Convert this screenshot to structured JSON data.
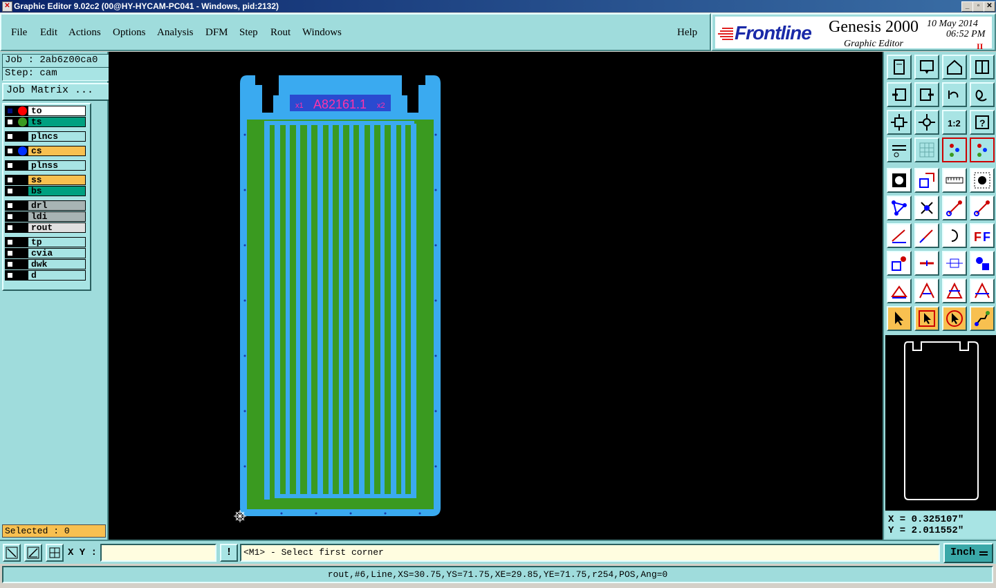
{
  "window": {
    "title": "Graphic Editor 9.02c2 (00@HY-HYCAM-PC041 - Windows, pid:2132)"
  },
  "menu": [
    {
      "label": "File"
    },
    {
      "label": "Edit"
    },
    {
      "label": "Actions"
    },
    {
      "label": "Options"
    },
    {
      "label": "Analysis"
    },
    {
      "label": "DFM"
    },
    {
      "label": "Step"
    },
    {
      "label": "Rout"
    },
    {
      "label": "Windows"
    }
  ],
  "help_label": "Help",
  "brand": {
    "logo_text": "Frontline",
    "product": "Genesis 2000",
    "subtitle": "Graphic Editor",
    "date": "10 May 2014",
    "time": "06:52 PM",
    "pause_mark": "II"
  },
  "job": {
    "job_line": "Job : 2ab6z00ca0",
    "step_line": "Step: cam",
    "matrix_button": "Job Matrix ..."
  },
  "layers": [
    {
      "name": "to",
      "bg": "#ffffff",
      "dot": "#ff0000",
      "active": true
    },
    {
      "name": "ts",
      "bg": "#00a080",
      "dot": "#3a9a20",
      "active": false
    },
    {
      "name": "plncs",
      "bg": "#a8e4e4",
      "dot": "",
      "active": false
    },
    {
      "name": "cs",
      "bg": "#f8c050",
      "dot": "#0030ff",
      "active": false
    },
    {
      "name": "plnss",
      "bg": "#a8e4e4",
      "dot": "",
      "active": false
    },
    {
      "name": "ss",
      "bg": "#f8c050",
      "dot": "",
      "active": false
    },
    {
      "name": "bs",
      "bg": "#00a080",
      "dot": "",
      "active": false
    },
    {
      "name": "drl",
      "bg": "#a8b4b4",
      "dot": "",
      "active": false
    },
    {
      "name": "ldi",
      "bg": "#a8b4b4",
      "dot": "",
      "active": false
    },
    {
      "name": "rout",
      "bg": "#e0e0e0",
      "dot": "",
      "active": false
    },
    {
      "name": "tp",
      "bg": "#a8e4e4",
      "dot": "",
      "active": false
    },
    {
      "name": "cvia",
      "bg": "#a8e4e4",
      "dot": "",
      "active": false
    },
    {
      "name": "dwk",
      "bg": "#a8e4e4",
      "dot": "",
      "active": false
    },
    {
      "name": "d",
      "bg": "#a8e4e4",
      "dot": "",
      "active": false
    }
  ],
  "selected": "Selected : 0",
  "board": {
    "label": "A82161.1",
    "x1": "x1",
    "x2": "x2",
    "colors": {
      "outline": "#3aaaf0",
      "copper": "#3a9a20",
      "text": "#ff33aa"
    }
  },
  "coords": {
    "x": "X = 0.325107\"",
    "y": "Y = 2.011552\""
  },
  "input": {
    "xy_label": "X Y :",
    "xy_value": "",
    "bang": "!",
    "prompt": "<M1> - Select first corner",
    "unit": "Inch"
  },
  "status": "rout,#6,Line,XS=30.75,YS=71.75,XE=29.85,YE=71.75,r254,POS,Ang=0",
  "toolbar_icons": [
    "open-job-icon",
    "save-icon",
    "home-icon",
    "window-split-icon",
    "import-icon",
    "export-icon",
    "undo-icon",
    "redo-icon",
    "zoom-fit-icon",
    "zoom-center-icon",
    "scale-icon",
    "help-icon",
    "tools-icon",
    "grid-icon",
    "layer-toggle-icon",
    "layer-toggle-2-icon",
    "pad-icon",
    "shape-icon",
    "measure-icon",
    "round-pad-icon",
    "nodes-icon",
    "delete-node-icon",
    "move-point-icon",
    "move-point-2-icon",
    "line-icon",
    "slash-icon",
    "arc-icon",
    "mirror-icon",
    "snap-icon",
    "horizontal-line-icon",
    "dimension-icon",
    "shapes-icon",
    "triangle-icon",
    "triangle-2-icon",
    "triangle-3-icon",
    "triangle-4-icon",
    "select-icon",
    "select-box-icon",
    "select-circle-icon",
    "route-icon"
  ]
}
